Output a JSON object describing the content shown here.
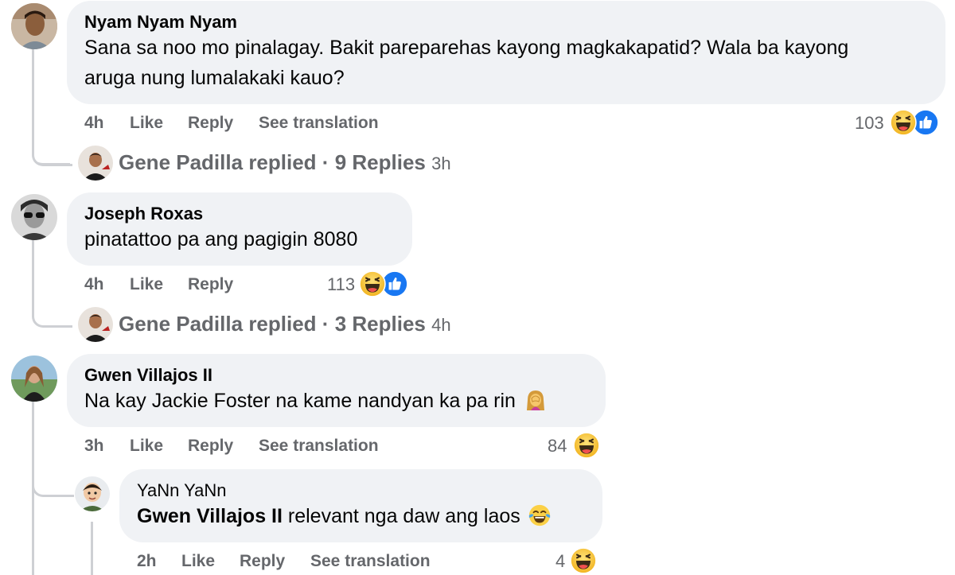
{
  "comments": [
    {
      "author": "Nyam Nyam Nyam",
      "text_line1": "Sana sa noo mo pinalagay. Bakit pareparehas kayong magkakapatid? Wala ba kayong",
      "text_line2": "aruga nung lumalakaki kauo?",
      "time": "4h",
      "like": "Like",
      "reply": "Reply",
      "translate": "See translation",
      "reaction_count": "103",
      "reactions": [
        "haha-icon",
        "like-icon"
      ],
      "replies": {
        "name": "Gene Padilla",
        "verb": "replied",
        "sep": "·",
        "count": "9 Replies",
        "time": "3h"
      }
    },
    {
      "author": "Joseph Roxas",
      "text": "pinatattoo pa ang pagigin 8080",
      "time": "4h",
      "like": "Like",
      "reply": "Reply",
      "reaction_count": "113",
      "reactions": [
        "haha-icon",
        "like-icon"
      ],
      "replies": {
        "name": "Gene Padilla",
        "verb": "replied",
        "sep": "·",
        "count": "3 Replies",
        "time": "4h"
      }
    },
    {
      "author": "Gwen Villajos II",
      "text": "Na kay Jackie Foster na kame nandyan ka pa rin",
      "text_emoji": "woman-facepalming-emoji",
      "time": "3h",
      "like": "Like",
      "reply": "Reply",
      "translate": "See translation",
      "reaction_count": "84",
      "reactions": [
        "haha-icon"
      ]
    }
  ],
  "reply": {
    "author": "YaNn YaNn",
    "tag": "Gwen Villajos II",
    "text": "relevant nga daw ang laos",
    "text_emoji": "tears-of-joy-emoji",
    "time": "2h",
    "like": "Like",
    "reply": "Reply",
    "translate": "See translation",
    "reaction_count": "4",
    "reactions": [
      "haha-icon"
    ]
  },
  "colors": {
    "bubble": "#f0f2f5",
    "meta": "#65676b",
    "like_blue": "#1877f2",
    "haha_yellow": "#f7b928"
  }
}
